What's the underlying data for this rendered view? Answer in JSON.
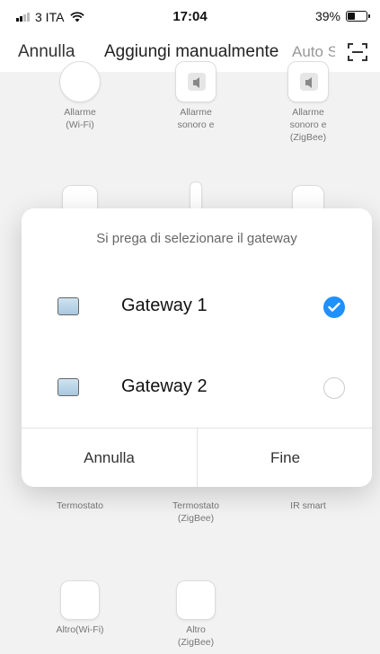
{
  "status_bar": {
    "carrier": "3 ITA",
    "time": "17:04",
    "battery_percent": "39%",
    "battery_level": 0.39
  },
  "nav": {
    "cancel_label": "Annulla",
    "title": "Aggiungi manualmente",
    "auto_label": "Auto S",
    "scan_icon": "scan-icon",
    "accent": "#1e90ff"
  },
  "devices": {
    "row1": [
      {
        "label": "Allarme\n(Wi-Fi)",
        "icon": "alarm-icon"
      },
      {
        "label": "Allarme\nsonoro e",
        "icon": "siren-icon"
      },
      {
        "label": "Allarme\nsonoro e\n(ZigBee)",
        "icon": "siren-icon"
      }
    ],
    "row3": [
      {
        "label": "Termostato"
      },
      {
        "label": "Termostato\n(ZigBee)"
      },
      {
        "label": "IR smart"
      }
    ],
    "row4": [
      {
        "label": "Altro(Wi-Fi)",
        "icon": "device-icon"
      },
      {
        "label": "Altro\n(ZigBee)",
        "icon": "device-icon"
      }
    ]
  },
  "dialog": {
    "title": "Si prega di selezionare il gateway",
    "gateways": [
      {
        "name": "Gateway 1",
        "selected": true
      },
      {
        "name": "Gateway 2",
        "selected": false
      }
    ],
    "cancel_label": "Annulla",
    "done_label": "Fine"
  }
}
